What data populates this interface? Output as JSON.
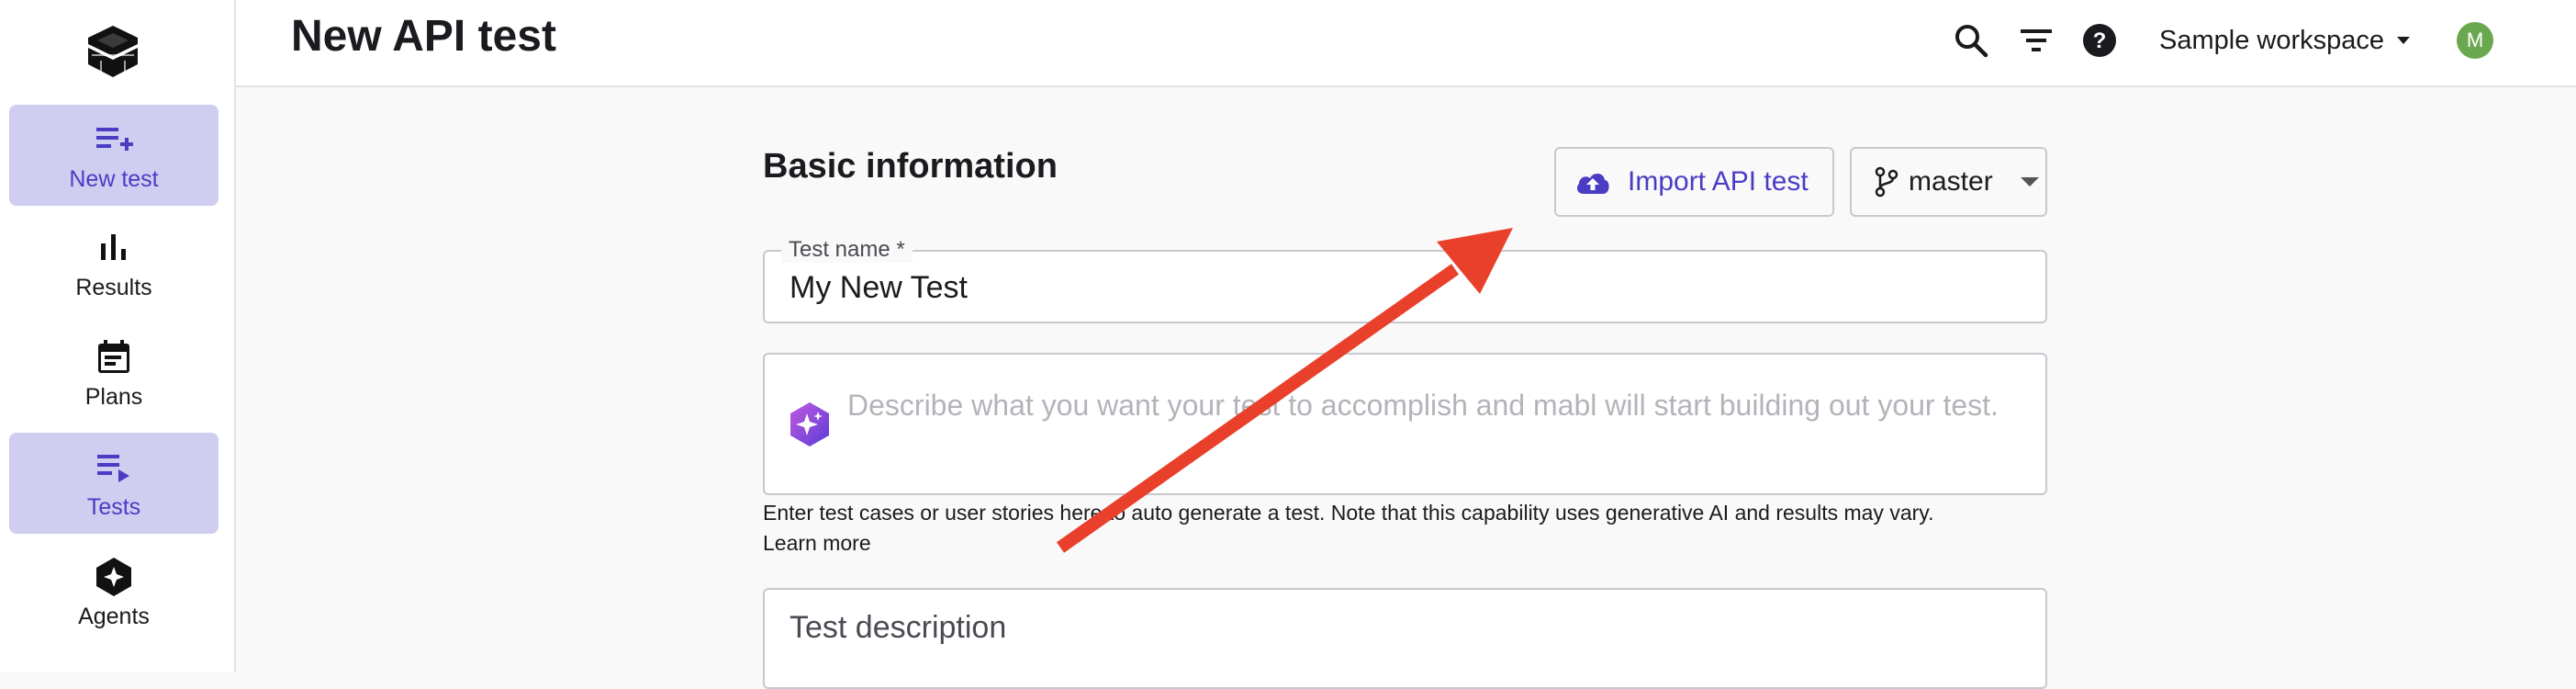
{
  "sidebar": {
    "items": [
      {
        "label": "New test",
        "icon": "playlist-add-icon",
        "active": true
      },
      {
        "label": "Results",
        "icon": "bar-chart-icon",
        "active": false
      },
      {
        "label": "Plans",
        "icon": "calendar-icon",
        "active": false
      },
      {
        "label": "Tests",
        "icon": "playlist-play-icon",
        "active": true
      },
      {
        "label": "Agents",
        "icon": "agents-icon",
        "active": false
      }
    ]
  },
  "header": {
    "title": "New API test",
    "workspace": "Sample workspace",
    "avatar_initial": "M"
  },
  "form": {
    "section_title": "Basic information",
    "import_label": "Import API test",
    "branch_label": "master",
    "test_name_label": "Test name *",
    "test_name_value": "My New Test",
    "ai_placeholder": "Describe what you want your test to accomplish and mabl will start building out your test.",
    "helper_text": "Enter test cases or user stories here to auto generate a test. Note that this capability uses generative AI and results may vary.",
    "learn_more": "Learn more",
    "description_placeholder": "Test description"
  },
  "colors": {
    "accent": "#4b3cc4",
    "nav_active_bg": "#cfcdf0",
    "annotation_arrow": "#e8402a",
    "avatar": "#6aa84f"
  }
}
